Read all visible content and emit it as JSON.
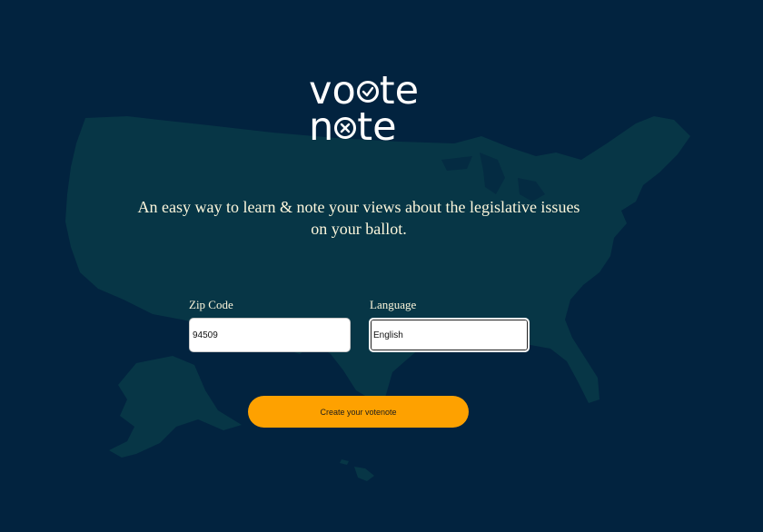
{
  "brand": {
    "logo_line1_start": "vo",
    "logo_line1_end": "te",
    "logo_line2_start": "n",
    "logo_line2_end": "te",
    "logo_text": "vote note"
  },
  "hero": {
    "tagline": "An easy way to learn & note your views about the legislative issues on your ballot."
  },
  "form": {
    "zip_label": "Zip Code",
    "zip_value": "94509",
    "language_label": "Language",
    "language_value": "English",
    "submit_label": "Create your votenote"
  },
  "colors": {
    "background": "#02233f",
    "map_fill": "#073646",
    "button": "#fea100",
    "text": "#fdf7dc"
  },
  "icons": {
    "logo_check": "check-circle-icon",
    "logo_cross": "x-circle-icon",
    "background_map": "us-map-silhouette"
  }
}
